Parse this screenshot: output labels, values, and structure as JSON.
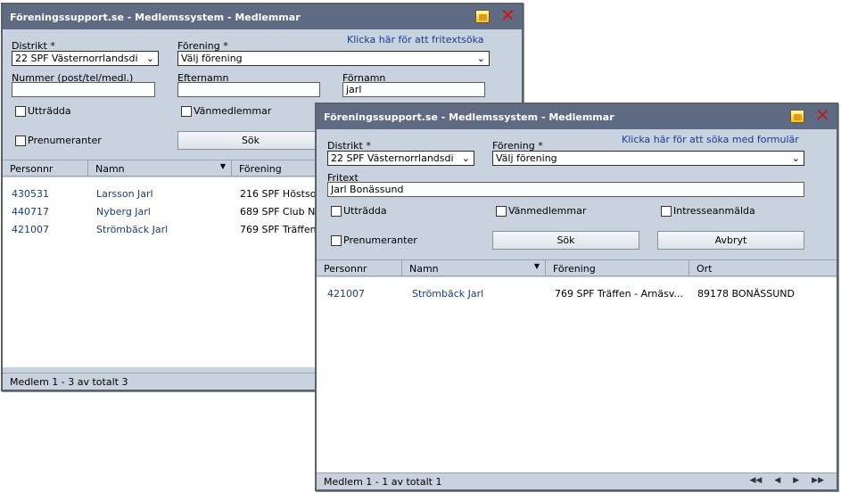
{
  "back_window": {
    "title": "Föreningssupport.se - Medlemssystem - Medlemmar",
    "distrikt_label": "Distrikt *",
    "distrikt_value": "22 SPF Västernorrlandsdi",
    "forening_label": "Förening *",
    "forening_value": "Välj förening",
    "search_link": "Klicka här för att fritextsöka",
    "nummer_label": "Nummer (post/tel/medl.)",
    "nummer_value": "",
    "efternamn_label": "Efternamn",
    "efternamn_value": "",
    "fornamn_label": "Förnamn",
    "fornamn_value": "jarl",
    "chk_utradda": "Utträdda",
    "chk_vanmedlemmar": "Vänmedlemmar",
    "chk_prenumeranter": "Prenumeranter",
    "search_button": "Sök",
    "columns": [
      "Personnr",
      "Namn",
      "Förening"
    ],
    "rows": [
      [
        "430531",
        "Larsson Jarl",
        "216 SPF Höstsol"
      ],
      [
        "440717",
        "Nyberg Jarl",
        "689 SPF Club N"
      ],
      [
        "421007",
        "Strömbäck Jarl",
        "769 SPF Träffen"
      ]
    ],
    "status": "Medlem 1 - 3 av totalt 3"
  },
  "front_window": {
    "title": "Föreningssupport.se - Medlemssystem - Medlemmar",
    "distrikt_label": "Distrikt *",
    "distrikt_value": "22 SPF Västernorrlandsdi",
    "forening_label": "Förening *",
    "forening_value": "Välj förening",
    "search_link": "Klicka här för att söka med formulär",
    "fritext_label": "Fritext",
    "fritext_value": "Jarl Bonässund",
    "chk_utradda": "Utträdda",
    "chk_vanmedlemmar": "Vänmedlemmar",
    "chk_intresseanmalda": "Intresseanmälda",
    "chk_prenumeranter": "Prenumeranter",
    "search_button": "Sök",
    "cancel_button": "Avbryt",
    "columns": [
      "Personnr",
      "Namn",
      "Förening",
      "Ort"
    ],
    "rows": [
      [
        "421007",
        "Strömbäck Jarl",
        "769 SPF Träffen - Arnäsv...",
        "89178 BONÄSSUND"
      ]
    ],
    "status": "Medlem 1 - 1 av totalt 1",
    "pager": [
      "◀◀",
      "◀",
      "▶",
      "▶▶"
    ]
  }
}
